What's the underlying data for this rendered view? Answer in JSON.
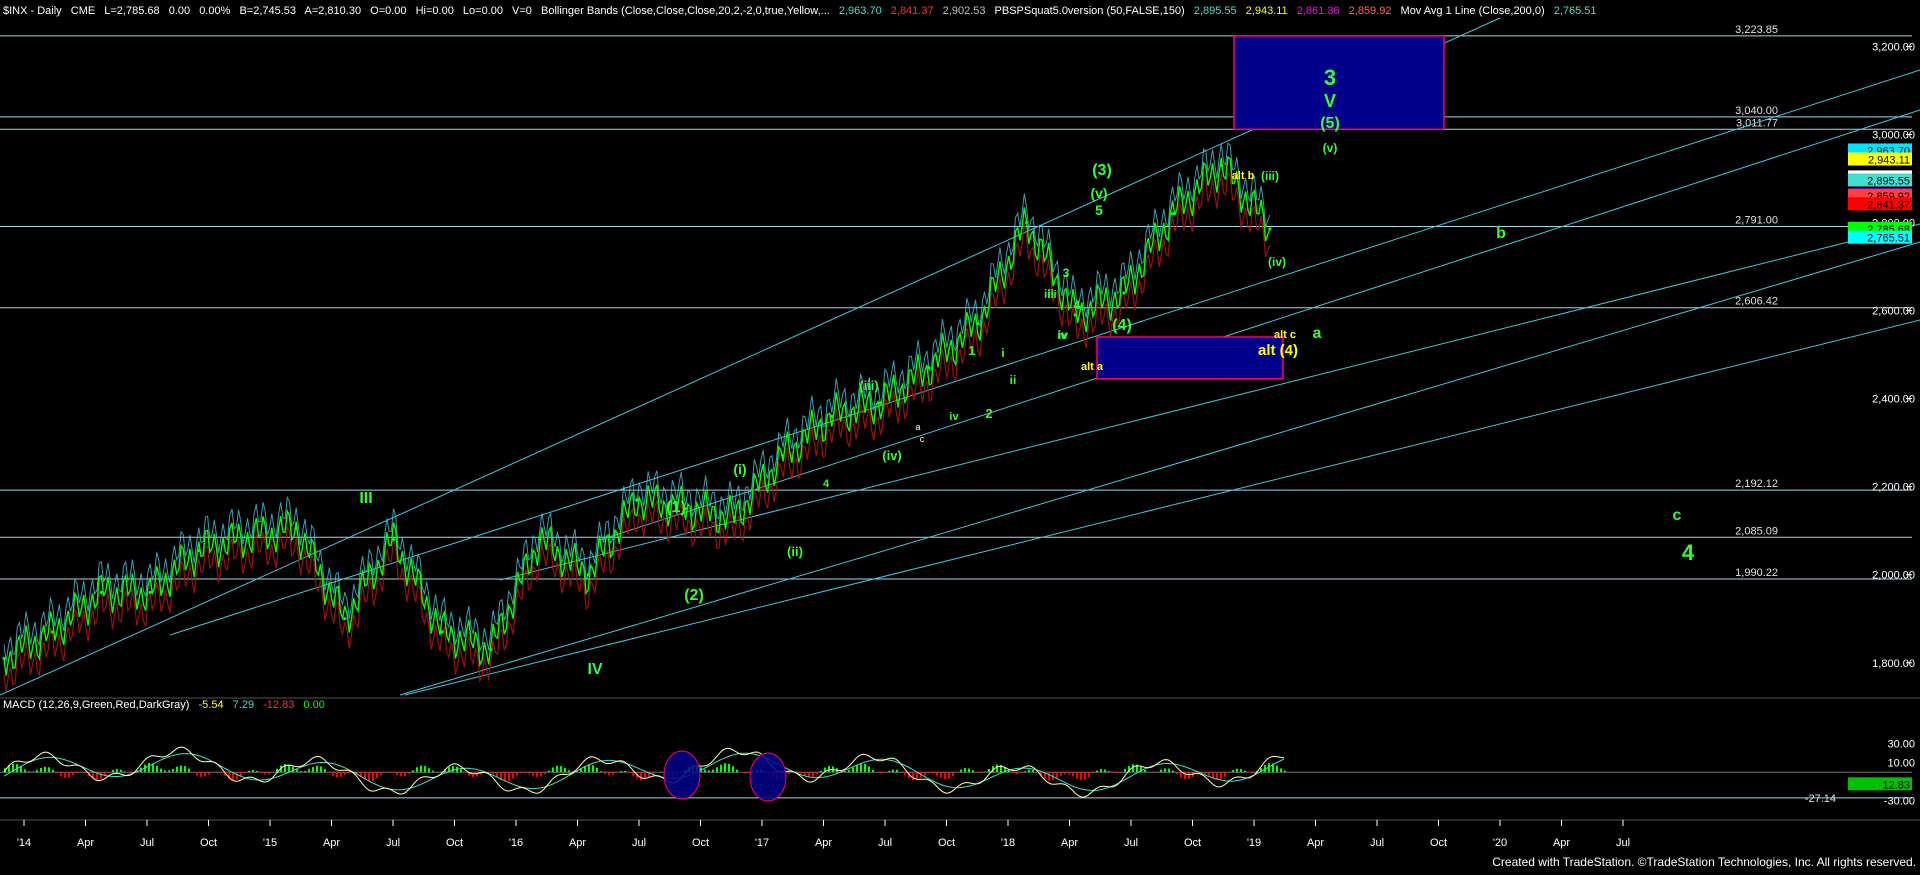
{
  "header": {
    "symbol": "$INX - Daily",
    "exchange": "CME",
    "last": "L=2,785.68",
    "change": "0.00",
    "change_pct": "0.00%",
    "bid": "B=2,745.53",
    "ask": "A=2,810.30",
    "open": "O=0.00",
    "high": "Hi=0.00",
    "low": "Lo=0.00",
    "volume": "V=0",
    "bollinger_label": "Bollinger Bands (Close,Close,Close,20,2,-2,0,true,Yellow,...",
    "bollinger_values": [
      "2,963.70",
      "2,841.37",
      "2,902.53"
    ],
    "squat_label": "PBSPSquat5.0version (50,FALSE,150)",
    "squat_values": [
      "2,895.55",
      "2,943.11",
      "2,861.36",
      "2,859.92"
    ],
    "mavg_label": "Mov Avg 1 Line (Close,200,0)",
    "mavg_value": "2,765.51"
  },
  "price_scale": {
    "ticks": [
      "3,200.00",
      "3,000.00",
      "2,800.00",
      "2,600.00",
      "2,400.00",
      "2,200.00",
      "2,000.00",
      "1,800.00"
    ],
    "ticks_values": [
      3200,
      3000,
      2800,
      2600,
      2400,
      2200,
      2000,
      1800
    ],
    "ylim": [
      1720,
      3260
    ],
    "price_badges": [
      {
        "text": "2,963.70",
        "value": 2963.7,
        "bg": "#00e5ff",
        "fg": "#000000"
      },
      {
        "text": "2,943.11",
        "value": 2943.11,
        "bg": "#ffff00",
        "fg": "#000000"
      },
      {
        "text": "2,902.53",
        "value": 2902.53,
        "bg": "#ffffff",
        "fg": "#000000"
      },
      {
        "text": "2,895.55",
        "value": 2895.55,
        "bg": "#40e0d0",
        "fg": "#000000"
      },
      {
        "text": "2,861.36",
        "value": 2861.36,
        "bg": "#ff00ff",
        "fg": "#000000"
      },
      {
        "text": "2,859.92",
        "value": 2859.92,
        "bg": "#ff4040",
        "fg": "#000000"
      },
      {
        "text": "2,841.37",
        "value": 2841.37,
        "bg": "#ff0000",
        "fg": "#000000"
      },
      {
        "text": "2,785.68",
        "value": 2785.68,
        "bg": "#00ff00",
        "fg": "#000000"
      },
      {
        "text": "2,765.51",
        "value": 2765.51,
        "bg": "#00ffff",
        "fg": "#000000"
      }
    ]
  },
  "horizontal_levels": [
    {
      "label": "3,223.85",
      "value": 3223.85
    },
    {
      "label": "3,040.00",
      "value": 3040
    },
    {
      "label": "3,011.77",
      "value": 3011.77
    },
    {
      "label": "2,791.00",
      "value": 2791
    },
    {
      "label": "2,606.42",
      "value": 2606.42
    },
    {
      "label": "2,192.12",
      "value": 2192.12
    },
    {
      "label": "2,085.09",
      "value": 2085.09
    },
    {
      "label": "1,990.22",
      "value": 1990.22
    }
  ],
  "macd": {
    "label": "MACD (12,26,9,Green,Red,DarkGray)",
    "values": [
      "-5.54",
      "7.29",
      "-12.83",
      "0.00"
    ],
    "value_colors": [
      "#ffff00",
      "#40e0d0",
      "#ff3030",
      "#00ff00"
    ],
    "ticks": [
      "30.00",
      "10.00",
      "-30.00"
    ],
    "ticks_values": [
      30,
      10,
      -30
    ],
    "ref_level": {
      "label": "-27.14",
      "value": -27.14
    },
    "badge": "-12.83",
    "ylim": [
      -42,
      55
    ]
  },
  "time_axis": {
    "labels": [
      "'14",
      "Apr",
      "Jul",
      "Oct",
      "'15",
      "Apr",
      "Jul",
      "Oct",
      "'16",
      "Apr",
      "Jul",
      "Oct",
      "'17",
      "Apr",
      "Jul",
      "Oct",
      "'18",
      "Apr",
      "Jul",
      "Oct",
      "'19",
      "Apr",
      "Jul",
      "Oct",
      "'20",
      "Apr",
      "Jul"
    ]
  },
  "wave_labels": {
    "green": [
      "III",
      "IV",
      "(1)",
      "(2)",
      "(i)",
      "(ii)",
      "(iii)",
      "(iv)",
      "1",
      "2",
      "i",
      "ii",
      "iii",
      "iv",
      "3",
      "4",
      "5",
      "(3)",
      "(v)",
      "(4)",
      "(iii)",
      "(iv)",
      "3",
      "V",
      "(5)",
      "(v)",
      "a",
      "b",
      "c",
      "4",
      "iv",
      "iii",
      "iv",
      "4"
    ],
    "yellow": [
      "alt b",
      "alt a",
      "alt c",
      "alt (4)"
    ],
    "white": [
      "a",
      "c"
    ]
  },
  "colors": {
    "background": "#000000",
    "price": "#00ff00",
    "channel": "#40c8e0",
    "level": "#9fd8e8",
    "box_fill": "#00008b",
    "box_border": "#ff0066",
    "axis_text": "#ffffff",
    "macd_fast": "#ffffaa",
    "macd_slow": "#40e0d0",
    "hist_up": "#00ff00",
    "hist_down": "#ff0000"
  },
  "footer": "Created with TradeStation. ©TradeStation Technologies, Inc. All rights reserved.",
  "chart_data": {
    "type": "line",
    "title": "$INX - Daily",
    "x": [
      "2014-01",
      "2014-04",
      "2014-07",
      "2014-10",
      "2015-01",
      "2015-04",
      "2015-07",
      "2015-08",
      "2015-10",
      "2016-01",
      "2016-02",
      "2016-04",
      "2016-06",
      "2016-07",
      "2016-09",
      "2016-11",
      "2017-01",
      "2017-03",
      "2017-05",
      "2017-07",
      "2017-10",
      "2018-01",
      "2018-02",
      "2018-04",
      "2018-07",
      "2018-09",
      "2018-10"
    ],
    "series": [
      {
        "values": [
          1810,
          1870,
          1960,
          1960,
          2055,
          2085,
          2105,
          1900,
          2080,
          1870,
          1830,
          2080,
          2000,
          2170,
          2150,
          2130,
          2270,
          2360,
          2390,
          2470,
          2570,
          2800,
          2590,
          2640,
          2820,
          2930,
          2785.68
        ]
      }
    ],
    "ylim": [
      1720,
      3260
    ],
    "xlabel": "",
    "ylabel": ""
  }
}
